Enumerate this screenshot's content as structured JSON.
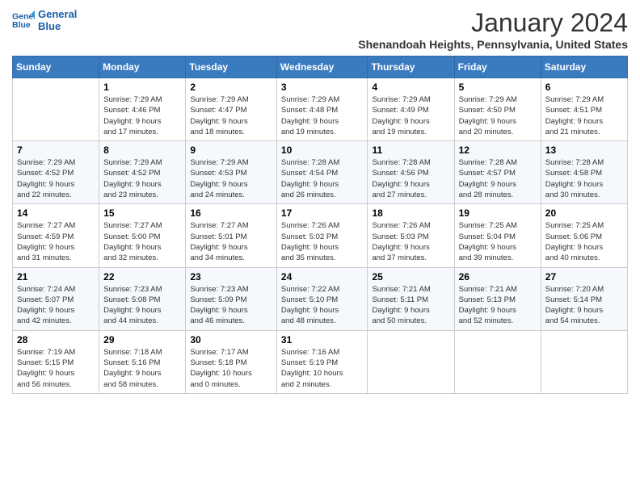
{
  "logo": {
    "line1": "General",
    "line2": "Blue"
  },
  "title": "January 2024",
  "subtitle": "Shenandoah Heights, Pennsylvania, United States",
  "days_header": [
    "Sunday",
    "Monday",
    "Tuesday",
    "Wednesday",
    "Thursday",
    "Friday",
    "Saturday"
  ],
  "weeks": [
    [
      {
        "num": "",
        "info": ""
      },
      {
        "num": "1",
        "info": "Sunrise: 7:29 AM\nSunset: 4:46 PM\nDaylight: 9 hours\nand 17 minutes."
      },
      {
        "num": "2",
        "info": "Sunrise: 7:29 AM\nSunset: 4:47 PM\nDaylight: 9 hours\nand 18 minutes."
      },
      {
        "num": "3",
        "info": "Sunrise: 7:29 AM\nSunset: 4:48 PM\nDaylight: 9 hours\nand 19 minutes."
      },
      {
        "num": "4",
        "info": "Sunrise: 7:29 AM\nSunset: 4:49 PM\nDaylight: 9 hours\nand 19 minutes."
      },
      {
        "num": "5",
        "info": "Sunrise: 7:29 AM\nSunset: 4:50 PM\nDaylight: 9 hours\nand 20 minutes."
      },
      {
        "num": "6",
        "info": "Sunrise: 7:29 AM\nSunset: 4:51 PM\nDaylight: 9 hours\nand 21 minutes."
      }
    ],
    [
      {
        "num": "7",
        "info": "Sunrise: 7:29 AM\nSunset: 4:52 PM\nDaylight: 9 hours\nand 22 minutes."
      },
      {
        "num": "8",
        "info": "Sunrise: 7:29 AM\nSunset: 4:52 PM\nDaylight: 9 hours\nand 23 minutes."
      },
      {
        "num": "9",
        "info": "Sunrise: 7:29 AM\nSunset: 4:53 PM\nDaylight: 9 hours\nand 24 minutes."
      },
      {
        "num": "10",
        "info": "Sunrise: 7:28 AM\nSunset: 4:54 PM\nDaylight: 9 hours\nand 26 minutes."
      },
      {
        "num": "11",
        "info": "Sunrise: 7:28 AM\nSunset: 4:56 PM\nDaylight: 9 hours\nand 27 minutes."
      },
      {
        "num": "12",
        "info": "Sunrise: 7:28 AM\nSunset: 4:57 PM\nDaylight: 9 hours\nand 28 minutes."
      },
      {
        "num": "13",
        "info": "Sunrise: 7:28 AM\nSunset: 4:58 PM\nDaylight: 9 hours\nand 30 minutes."
      }
    ],
    [
      {
        "num": "14",
        "info": "Sunrise: 7:27 AM\nSunset: 4:59 PM\nDaylight: 9 hours\nand 31 minutes."
      },
      {
        "num": "15",
        "info": "Sunrise: 7:27 AM\nSunset: 5:00 PM\nDaylight: 9 hours\nand 32 minutes."
      },
      {
        "num": "16",
        "info": "Sunrise: 7:27 AM\nSunset: 5:01 PM\nDaylight: 9 hours\nand 34 minutes."
      },
      {
        "num": "17",
        "info": "Sunrise: 7:26 AM\nSunset: 5:02 PM\nDaylight: 9 hours\nand 35 minutes."
      },
      {
        "num": "18",
        "info": "Sunrise: 7:26 AM\nSunset: 5:03 PM\nDaylight: 9 hours\nand 37 minutes."
      },
      {
        "num": "19",
        "info": "Sunrise: 7:25 AM\nSunset: 5:04 PM\nDaylight: 9 hours\nand 39 minutes."
      },
      {
        "num": "20",
        "info": "Sunrise: 7:25 AM\nSunset: 5:06 PM\nDaylight: 9 hours\nand 40 minutes."
      }
    ],
    [
      {
        "num": "21",
        "info": "Sunrise: 7:24 AM\nSunset: 5:07 PM\nDaylight: 9 hours\nand 42 minutes."
      },
      {
        "num": "22",
        "info": "Sunrise: 7:23 AM\nSunset: 5:08 PM\nDaylight: 9 hours\nand 44 minutes."
      },
      {
        "num": "23",
        "info": "Sunrise: 7:23 AM\nSunset: 5:09 PM\nDaylight: 9 hours\nand 46 minutes."
      },
      {
        "num": "24",
        "info": "Sunrise: 7:22 AM\nSunset: 5:10 PM\nDaylight: 9 hours\nand 48 minutes."
      },
      {
        "num": "25",
        "info": "Sunrise: 7:21 AM\nSunset: 5:11 PM\nDaylight: 9 hours\nand 50 minutes."
      },
      {
        "num": "26",
        "info": "Sunrise: 7:21 AM\nSunset: 5:13 PM\nDaylight: 9 hours\nand 52 minutes."
      },
      {
        "num": "27",
        "info": "Sunrise: 7:20 AM\nSunset: 5:14 PM\nDaylight: 9 hours\nand 54 minutes."
      }
    ],
    [
      {
        "num": "28",
        "info": "Sunrise: 7:19 AM\nSunset: 5:15 PM\nDaylight: 9 hours\nand 56 minutes."
      },
      {
        "num": "29",
        "info": "Sunrise: 7:18 AM\nSunset: 5:16 PM\nDaylight: 9 hours\nand 58 minutes."
      },
      {
        "num": "30",
        "info": "Sunrise: 7:17 AM\nSunset: 5:18 PM\nDaylight: 10 hours\nand 0 minutes."
      },
      {
        "num": "31",
        "info": "Sunrise: 7:16 AM\nSunset: 5:19 PM\nDaylight: 10 hours\nand 2 minutes."
      },
      {
        "num": "",
        "info": ""
      },
      {
        "num": "",
        "info": ""
      },
      {
        "num": "",
        "info": ""
      }
    ]
  ]
}
